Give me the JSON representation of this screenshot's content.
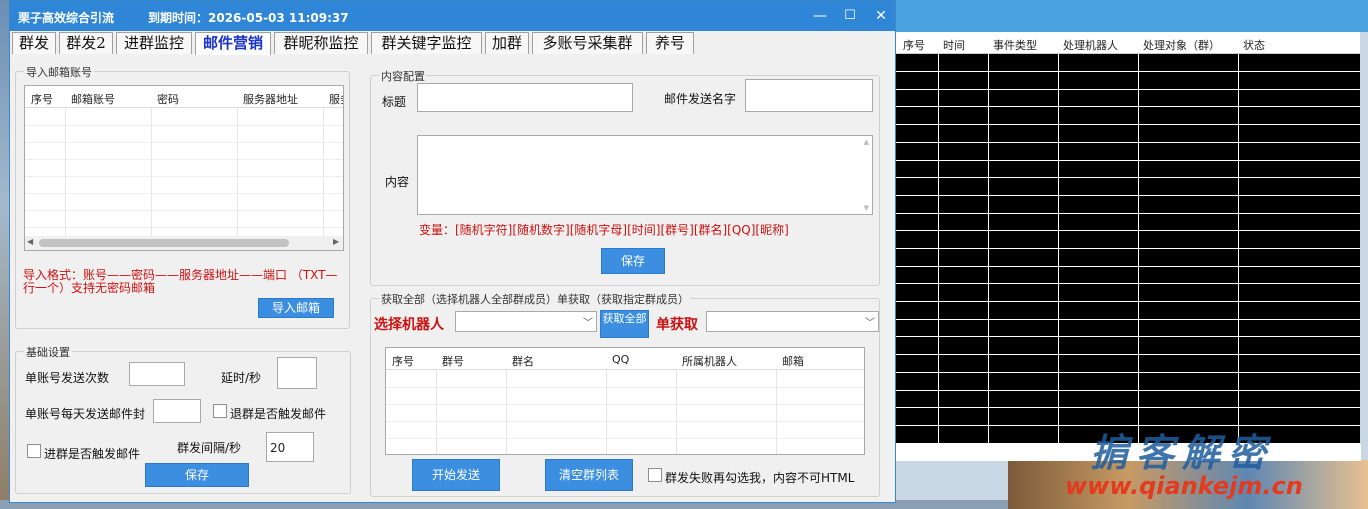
{
  "app": {
    "title": "栗子高效综合引流",
    "expire": "到期时间：2026-05-03 11:09:37",
    "minimize": "—",
    "maximize": "☐",
    "close": "✕"
  },
  "tabs": [
    "群发",
    "群发2",
    "进群监控",
    "邮件营销",
    "群昵称监控",
    "群关键字监控",
    "加群",
    "多账号采集群",
    "养号"
  ],
  "import_group": {
    "label": "导入邮箱账号",
    "columns": [
      "序号",
      "邮箱账号",
      "密码",
      "服务器地址",
      "服务"
    ],
    "format_text": "导入格式：账号——密码——服务器地址——端口 （TXT—行一个）支持无密码邮箱",
    "import_button": "导入邮箱"
  },
  "basic": {
    "label": "基础设置",
    "send_count_label": "单账号发送次数",
    "delay_label": "延时/秒",
    "daily_label": "单账号每天发送邮件封",
    "quit_trigger": "退群是否触发邮件",
    "join_trigger": "进群是否触发邮件",
    "interval_label": "群发间隔/秒",
    "interval_value": "20",
    "save_button": "保存"
  },
  "content": {
    "label": "内容配置",
    "title_label": "标题",
    "sender_label": "邮件发送名字",
    "body_label": "内容",
    "variables": "变量：[随机字符][随机数字][随机字母][时间][群号][群名][QQ][昵称]",
    "save_button": "保存"
  },
  "fetch": {
    "label": "获取全部（选择机器人全部群成员）单获取（获取指定群成员）",
    "select_robot": "选择机器人",
    "get_all_button": "获取全部",
    "single_get": "单获取",
    "columns": [
      "序号",
      "群号",
      "群名",
      "QQ",
      "所属机器人",
      "邮箱"
    ],
    "start_button": "开始发送",
    "clear_button": "清空群列表",
    "fail_check": "群发失败再勾选我，内容不可HTML"
  },
  "events": {
    "columns": [
      "序号",
      "时间",
      "事件类型",
      "处理机器人",
      "处理对象（群）",
      "状态"
    ]
  },
  "watermark": {
    "cn": "掮客解密",
    "url": "www.qiankejm.cn"
  }
}
